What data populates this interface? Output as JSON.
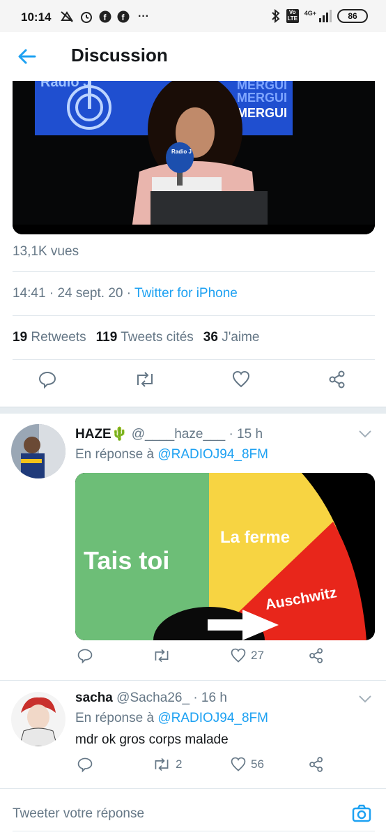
{
  "status_bar": {
    "time": "10:14",
    "notification_icons": [
      "silent-icon",
      "alarm-icon",
      "facebook-icon",
      "facebook-icon",
      "more-dots-icon"
    ],
    "more": "···",
    "network": "4G+",
    "volte": "Vo LTE",
    "battery": "86"
  },
  "header": {
    "title": "Discussion",
    "back_icon": "back-arrow-icon"
  },
  "main_tweet": {
    "video_labels": {
      "logo": "Radio J",
      "banner": [
        "MERGUI",
        "MERGUI",
        "MERGUI"
      ],
      "mic": "Radio J"
    },
    "views": "13,1K vues",
    "time": "14:41",
    "sep1": " · ",
    "date": "24 sept. 20",
    "sep2": " · ",
    "source": "Twitter for iPhone",
    "stats": {
      "retweets_count": "19",
      "retweets_label": "Retweets",
      "quotes_count": "119",
      "quotes_label": "Tweets cités",
      "likes_count": "36",
      "likes_label": "J'aime"
    }
  },
  "replies": [
    {
      "name": "HAZE",
      "emoji": "🌵",
      "handle": "@____haze___",
      "time": "· 15 h",
      "reply_prefix": "En réponse à ",
      "reply_handle": "@RADIOJ94_8FM",
      "text": "",
      "meme": {
        "green_label": "Tais toi",
        "yellow_label": "La ferme",
        "red_label": "Auschwitz",
        "colors": {
          "green": "#6dbe77",
          "yellow": "#f7d442",
          "red": "#e8261b"
        }
      },
      "replies_count": "",
      "retweets_count": "",
      "likes_count": "27"
    },
    {
      "name": "sacha",
      "handle": "@Sacha26_",
      "time": "· 16 h",
      "reply_prefix": "En réponse à ",
      "reply_handle": "@RADIOJ94_8FM",
      "text": "mdr ok gros corps malade",
      "replies_count": "",
      "retweets_count": "2",
      "likes_count": "56"
    }
  ],
  "composer": {
    "placeholder": "Tweeter votre réponse",
    "camera_icon": "camera-icon"
  },
  "colors": {
    "accent": "#1da1f2",
    "secondary_text": "#657786",
    "primary_text": "#14171a",
    "divider": "#e1e8ed"
  }
}
